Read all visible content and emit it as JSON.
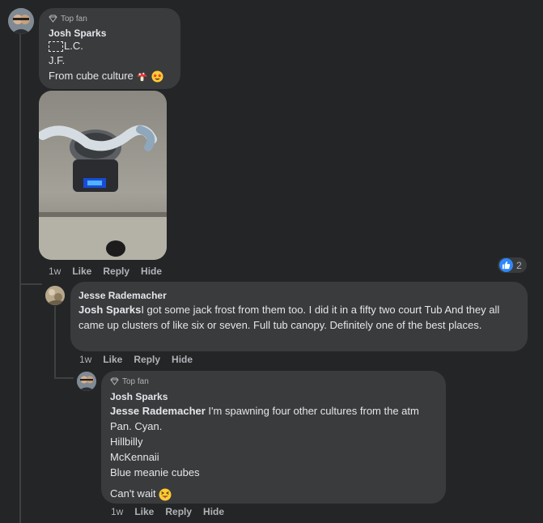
{
  "comment1": {
    "badge": "Top fan",
    "name": "Josh Sparks",
    "line1_suffix": "L.C.",
    "line2": "J.F.",
    "line3": "From cube culture",
    "time": "1w",
    "like": "Like",
    "reply": "Reply",
    "hide": "Hide",
    "reaction_count": "2"
  },
  "reply1": {
    "name": "Jesse Rademacher",
    "mention": "Josh Sparks",
    "text": "I got some jack frost from them too. I did it in a fifty two court Tub And they all came up clusters of like six or seven. Full tub canopy. Definitely one of the best places.",
    "time": "1w",
    "like": "Like",
    "reply": "Reply",
    "hide": "Hide"
  },
  "reply2": {
    "badge": "Top fan",
    "name": "Josh Sparks",
    "mention": "Jesse Rademacher",
    "text": " I'm spawning four other cultures from the atm",
    "lines": [
      "Pan. Cyan.",
      "Hillbilly",
      "McKennaii",
      "Blue meanie cubes"
    ],
    "closing": "Can't wait",
    "time": "1w",
    "like": "Like",
    "reply": "Reply",
    "hide": "Hide"
  },
  "colors": {
    "background": "#242526",
    "bubble": "#3a3b3c",
    "like_blue": "#2d88ff"
  }
}
